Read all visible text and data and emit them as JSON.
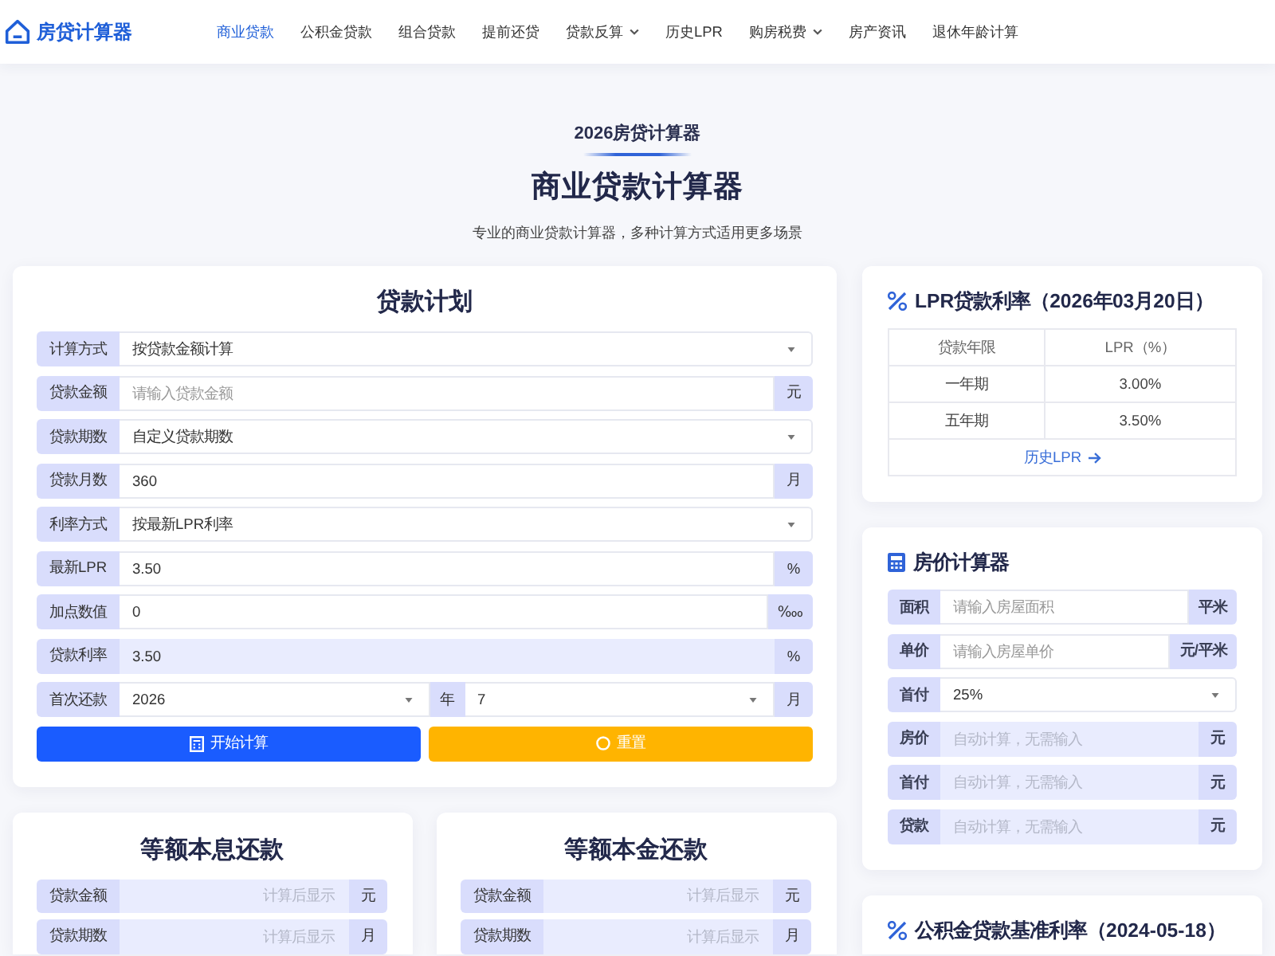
{
  "header": {
    "logo": "房贷计算器",
    "nav": [
      {
        "label": "商业贷款",
        "selected": true,
        "dropdown": false
      },
      {
        "label": "公积金贷款",
        "selected": false,
        "dropdown": false
      },
      {
        "label": "组合贷款",
        "selected": false,
        "dropdown": false
      },
      {
        "label": "提前还贷",
        "selected": false,
        "dropdown": false
      },
      {
        "label": "贷款反算",
        "selected": false,
        "dropdown": true
      },
      {
        "label": "历史LPR",
        "selected": false,
        "dropdown": false
      },
      {
        "label": "购房税费",
        "selected": false,
        "dropdown": true
      },
      {
        "label": "房产资讯",
        "selected": false,
        "dropdown": false
      },
      {
        "label": "退休年龄计算",
        "selected": false,
        "dropdown": false
      }
    ]
  },
  "hero": {
    "kicker": "2026房贷计算器",
    "title": "商业贷款计算器",
    "subtitle": "专业的商业贷款计算器，多种计算方式适用更多场景"
  },
  "loan_plan": {
    "title": "贷款计划",
    "fields": [
      {
        "kind": "select",
        "label": "计算方式",
        "value": "按贷款金额计算"
      },
      {
        "kind": "input",
        "label": "贷款金额",
        "placeholder": "请输入贷款金额",
        "unit": "元"
      },
      {
        "kind": "select",
        "label": "贷款期数",
        "value": "自定义贷款期数"
      },
      {
        "kind": "input",
        "label": "贷款月数",
        "value": "360",
        "unit": "月"
      },
      {
        "kind": "select",
        "label": "利率方式",
        "value": "按最新LPR利率"
      },
      {
        "kind": "input",
        "label": "最新LPR",
        "value": "3.50",
        "unit": "%"
      },
      {
        "kind": "input",
        "label": "加点数值",
        "value": "0",
        "unit": "‱"
      },
      {
        "kind": "readonly",
        "label": "贷款利率",
        "value": "3.50",
        "unit": "%"
      },
      {
        "kind": "date",
        "label": "首次还款",
        "year": "2026",
        "year_unit": "年",
        "month": "7",
        "month_unit": "月"
      }
    ],
    "buttons": [
      {
        "kind": "calculate",
        "label": "开始计算"
      },
      {
        "kind": "reset",
        "label": "重置"
      }
    ]
  },
  "results": [
    {
      "title": "等额本息还款",
      "fields": [
        {
          "kind": "readonly",
          "label": "贷款金额",
          "placeholder": "计算后显示",
          "unit": "元"
        },
        {
          "kind": "readonly",
          "label": "贷款期数",
          "placeholder": "计算后显示",
          "unit": "月"
        }
      ]
    },
    {
      "title": "等额本金还款",
      "fields": [
        {
          "kind": "readonly",
          "label": "贷款金额",
          "placeholder": "计算后显示",
          "unit": "元"
        },
        {
          "kind": "readonly",
          "label": "贷款期数",
          "placeholder": "计算后显示",
          "unit": "月"
        }
      ]
    }
  ],
  "lpr_card": {
    "title": "LPR贷款利率（2026年03月20日）",
    "columns": [
      "贷款年限",
      "LPR（%）"
    ],
    "rows": [
      [
        "一年期",
        "3.00%"
      ],
      [
        "五年期",
        "3.50%"
      ]
    ],
    "link": "历史LPR"
  },
  "price_calculator": {
    "title": "房价计算器",
    "fields": [
      {
        "kind": "input",
        "label": "面积",
        "placeholder": "请输入房屋面积",
        "unit": "平米"
      },
      {
        "kind": "input",
        "label": "单价",
        "placeholder": "请输入房屋单价",
        "unit": "元/平米"
      },
      {
        "kind": "select",
        "label": "首付",
        "value": "25%"
      },
      {
        "kind": "readonly",
        "label": "房价",
        "placeholder": "自动计算，无需输入",
        "unit": "元"
      },
      {
        "kind": "readonly",
        "label": "首付",
        "placeholder": "自动计算，无需输入",
        "unit": "元"
      },
      {
        "kind": "readonly",
        "label": "贷款",
        "placeholder": "自动计算，无需输入",
        "unit": "元"
      }
    ]
  },
  "fund_rate_card": {
    "title": "公积金贷款基准利率（2024-05-18）"
  }
}
